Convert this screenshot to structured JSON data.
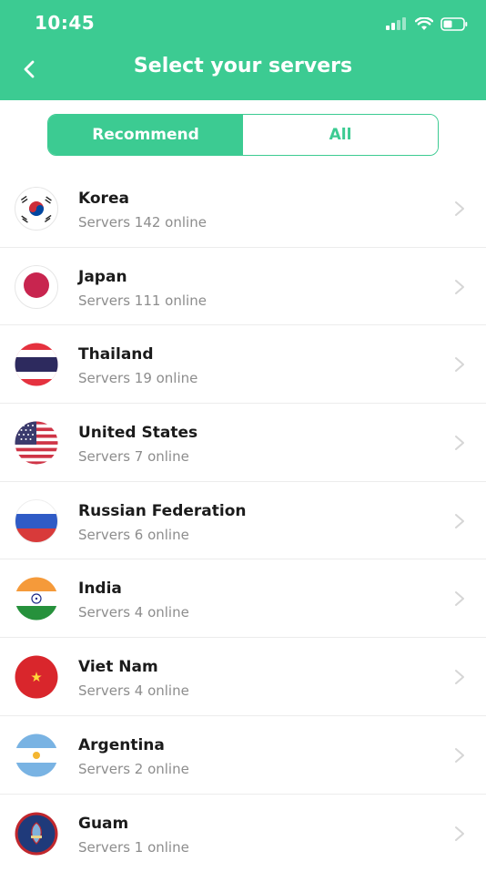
{
  "status_bar": {
    "time": "10:45"
  },
  "nav": {
    "title": "Select your servers"
  },
  "tabs": [
    {
      "label": "Recommend",
      "active": true
    },
    {
      "label": "All",
      "active": false
    }
  ],
  "colors": {
    "accent": "#3ccb92",
    "secondary_text": "#8d8d8d",
    "divider": "#ececec"
  },
  "servers": [
    {
      "country": "Korea",
      "status": "Servers 142 online",
      "flag_icon": "korea-flag-icon"
    },
    {
      "country": "Japan",
      "status": "Servers 111 online",
      "flag_icon": "japan-flag-icon"
    },
    {
      "country": "Thailand",
      "status": "Servers 19 online",
      "flag_icon": "thailand-flag-icon"
    },
    {
      "country": "United States",
      "status": "Servers 7 online",
      "flag_icon": "usa-flag-icon"
    },
    {
      "country": "Russian Federation",
      "status": "Servers 6 online",
      "flag_icon": "russia-flag-icon"
    },
    {
      "country": "India",
      "status": "Servers 4 online",
      "flag_icon": "india-flag-icon"
    },
    {
      "country": "Viet Nam",
      "status": "Servers 4 online",
      "flag_icon": "vietnam-flag-icon"
    },
    {
      "country": "Argentina",
      "status": "Servers 2 online",
      "flag_icon": "argentina-flag-icon"
    },
    {
      "country": "Guam",
      "status": "Servers 1 online",
      "flag_icon": "guam-flag-icon"
    }
  ]
}
